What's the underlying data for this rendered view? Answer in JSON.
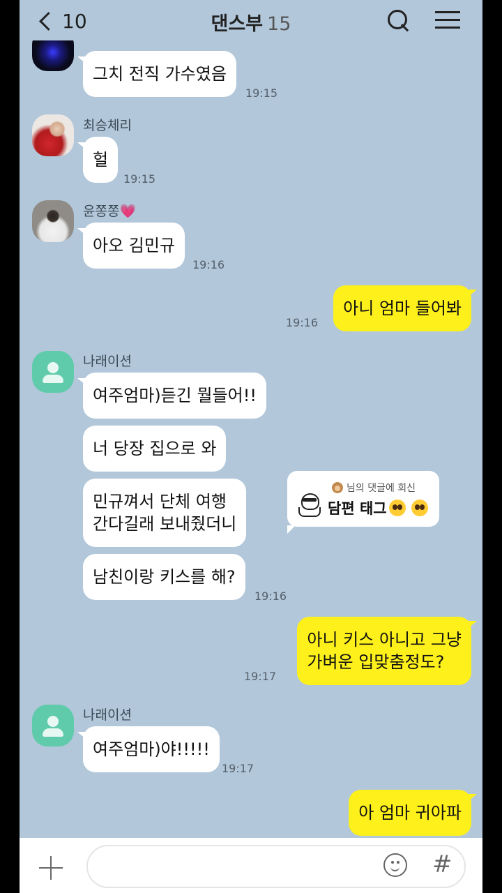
{
  "header": {
    "back_count": "10",
    "title": "댄스부",
    "member_count": "15"
  },
  "messages": {
    "m1": {
      "text": "그치 전직 가수였음",
      "time": "19:15"
    },
    "m2": {
      "sender": "최승체리",
      "text": "헐",
      "time": "19:15"
    },
    "m3": {
      "sender": "윤쫑쫑💗",
      "text": "아오 김민규",
      "time": "19:16"
    },
    "m4": {
      "text": "아니 엄마 들어봐",
      "time": "19:16"
    },
    "m5": {
      "sender": "나래이션",
      "b1": "여주엄마)듣긴 뭘들어!!",
      "b2": "너 당장 집으로 와",
      "b3": "민규껴서 단체 여행\n간다길래 보내줬더니",
      "b4": "남친이랑 키스를 해?",
      "time": "19:16"
    },
    "m6": {
      "text": "아니 키스 아니고 그냥\n가벼운 입맞춤정도?",
      "time": "19:17"
    },
    "m7": {
      "sender": "나래이션",
      "text": "여주엄마)야!!!!!",
      "time": "19:17"
    },
    "m8": {
      "text": "아 엄마 귀아파"
    }
  },
  "reply_card": {
    "sub": "님의 댓글에 회신",
    "main": "담편 태그"
  },
  "input": {
    "placeholder": ""
  },
  "colors": {
    "bg": "#b2c7da",
    "my_bubble": "#fef01b",
    "other_bubble": "#ffffff",
    "avatar_default": "#5fcbaa"
  }
}
